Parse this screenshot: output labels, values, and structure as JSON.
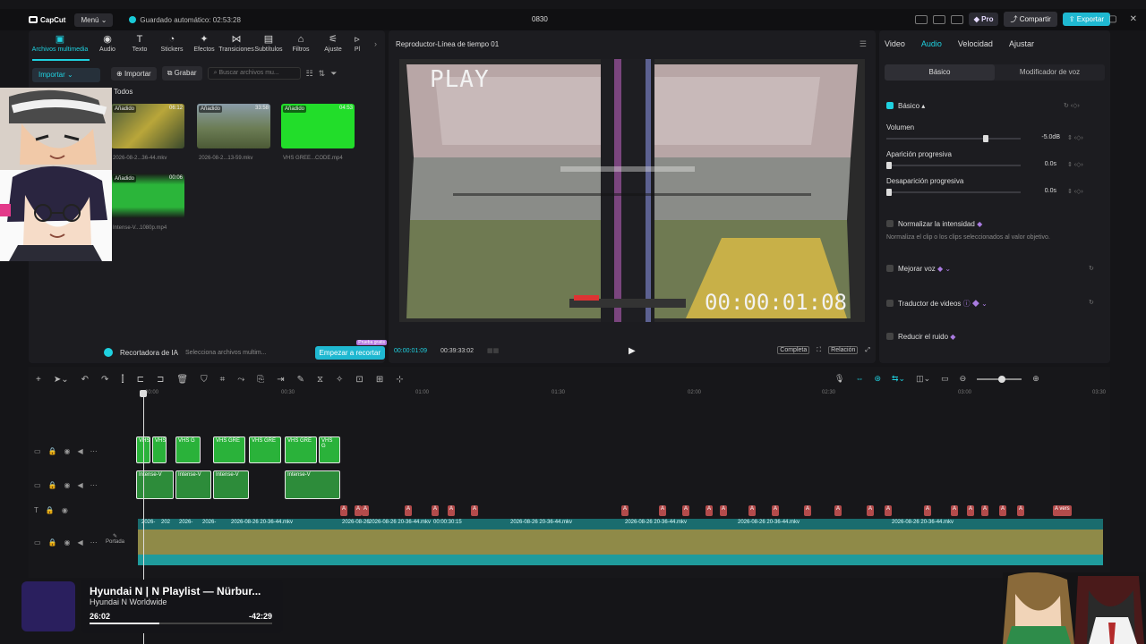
{
  "titlebar": {
    "app_name": "CapCut",
    "menu_label": "Menú",
    "autosave": "Guardado automático: 02:53:28",
    "project_title": "0830",
    "pro_label": "Pro",
    "share_label": "Compartir",
    "export_label": "Exportar"
  },
  "media_tabs": [
    {
      "label": "Archivos multimedia",
      "icon": "media-icon"
    },
    {
      "label": "Audio",
      "icon": "audio-icon"
    },
    {
      "label": "Texto",
      "icon": "text-icon"
    },
    {
      "label": "Stickers",
      "icon": "sticker-icon"
    },
    {
      "label": "Efectos",
      "icon": "effects-icon"
    },
    {
      "label": "Transiciones",
      "icon": "transitions-icon"
    },
    {
      "label": "Subtítulos",
      "icon": "subtitles-icon"
    },
    {
      "label": "Filtros",
      "icon": "filters-icon"
    },
    {
      "label": "Ajuste",
      "icon": "adjust-icon"
    },
    {
      "label": "Pl",
      "icon": "plugin-icon"
    }
  ],
  "media": {
    "side_import": "Importar",
    "import_btn": "Importar",
    "record_btn": "Grabar",
    "search_placeholder": "Buscar archivos mu...",
    "section": "Todos",
    "items": [
      {
        "badge": "Añadido",
        "duration": "06:12",
        "name": "2026-08-2...36-44.mkv"
      },
      {
        "badge": "Añadido",
        "duration": "33:58",
        "name": "2026-08-2...13-59.mkv"
      },
      {
        "badge": "Añadido",
        "duration": "04:53",
        "name": "VHS GREE...CODE.mp4"
      },
      {
        "badge": "Añadido",
        "duration": "00:06",
        "name": "Intense-V...1080p.mp4"
      }
    ],
    "ai_title": "Recortadora de IA",
    "ai_hint": "Selecciona archivos multim...",
    "ai_start": "Empezar a recortar",
    "ai_badge": "Prueba gratis"
  },
  "player": {
    "title": "Reproductor-Línea de tiempo 01",
    "overlay_play": "PLAY",
    "overlay_time": "00:00:01:08",
    "current_time": "00:00:01:09",
    "total_time": "00:39:33:02",
    "full_label": "Completa",
    "ratio_label": "Relación"
  },
  "inspector": {
    "tabs": [
      "Video",
      "Audio",
      "Velocidad",
      "Ajustar"
    ],
    "active_tab": "Audio",
    "seg_basic": "Básico",
    "seg_voice": "Modificador de voz",
    "basic_label": "Básico",
    "volume_label": "Volumen",
    "volume_value": "-5.0dB",
    "fadein_label": "Aparición progresiva",
    "fadein_value": "0.0s",
    "fadeout_label": "Desaparición progresiva",
    "fadeout_value": "0.0s",
    "normalize_label": "Normalizar la intensidad",
    "normalize_note": "Normaliza el clip o los clips seleccionados al valor objetivo.",
    "enhance_label": "Mejorar voz",
    "translate_label": "Traductor de videos",
    "noise_label": "Reducir el ruido"
  },
  "timeline": {
    "ruler": [
      "00:00",
      "00:30",
      "01:00",
      "01:30",
      "02:00",
      "02:30",
      "03:00",
      "03:30"
    ],
    "green_clips_top": [
      "VHS",
      "VHS",
      "VHS G",
      "VHS GRE",
      "VHS GRE",
      "VHS GRE",
      "VHS G"
    ],
    "green_clips_bottom": [
      "Intense-V",
      "Intense-V",
      "Intense-V",
      "Intense-V"
    ],
    "markers": [
      "A",
      "A",
      "A",
      "A",
      "A",
      "A",
      "A",
      "A",
      "A",
      "A",
      "A",
      "A",
      "A",
      "A",
      "A",
      "A",
      "A",
      "A",
      "A",
      "A",
      "A",
      "A",
      "A",
      "A",
      "A vers"
    ],
    "main_labels": [
      "2026-",
      "202",
      "2026-",
      "2026-",
      "2026-08-26 20-36-44.mkv",
      "2026-08-26",
      "2026-08-26 20-36-44.mkv",
      "00:00:30:15",
      "2026-08-26 20-36-44.mkv",
      "2026-08-26 20-36-44.mkv",
      "2026-08-26 20-36-44.mkv",
      "2026-08-26 20-36-44.mkv"
    ],
    "cover_label": "Portada"
  },
  "media_widget": {
    "title": "Hyundai N | N Playlist — Nürbur...",
    "artist": "Hyundai N Worldwide",
    "elapsed": "26:02",
    "remaining": "-42:29",
    "progress": 0.38
  }
}
